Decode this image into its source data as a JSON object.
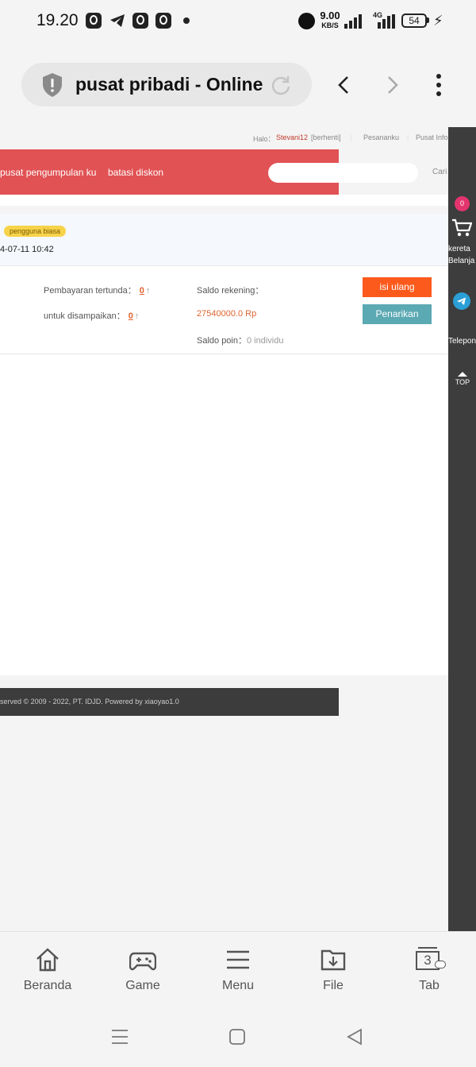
{
  "status_bar": {
    "time": "19.20",
    "speed_value": "9.00",
    "speed_unit": "KB/S",
    "network": "4G",
    "battery": "54"
  },
  "browser": {
    "title": "pusat pribadi - Online"
  },
  "page": {
    "top_links": {
      "greeting": "Halo：",
      "username": "Stevani12",
      "logout": "[berhenti]",
      "orders": "Pesananku",
      "info_center": "Pusat Info"
    },
    "nav": {
      "collection": "pusat pengumpulan ku",
      "discount": "batasi diskon"
    },
    "search_label": "Cari",
    "user": {
      "badge": "pengguna biasa",
      "login_time": "4-07-11 10:42"
    },
    "account": {
      "pending_payment_label": "Pembayaran tertunda：",
      "pending_payment_value": "0",
      "to_deliver_label": "untuk disampaikan：",
      "to_deliver_value": "0",
      "balance_label": "Saldo rekening：",
      "balance_value": "27540000.0 Rp",
      "points_label": "Saldo poin：",
      "points_value": "0 individu",
      "recharge_button": "isi ulang",
      "withdraw_button": "Penarikan"
    },
    "footer": "served © 2009 - 2022, PT. IDJD.   Powered by xiaoyao1.0"
  },
  "sidebar": {
    "cart_count": "0",
    "cart_label": "kereta Belanja",
    "telegram_label": "Telepon",
    "top_label": "TOP"
  },
  "bottom_nav": {
    "tabs": [
      {
        "label": "Beranda",
        "icon": "home-icon"
      },
      {
        "label": "Game",
        "icon": "gamepad-icon"
      },
      {
        "label": "Menu",
        "icon": "menu-icon"
      },
      {
        "label": "File",
        "icon": "folder-download-icon"
      },
      {
        "label": "Tab",
        "icon": "tabs-icon",
        "count": "3"
      }
    ]
  },
  "colors": {
    "nav_red": "#e15254",
    "recharge_orange": "#fb5a1c",
    "withdraw_teal": "#5aa9b3",
    "sidebar_dark": "#3d3d3d"
  }
}
